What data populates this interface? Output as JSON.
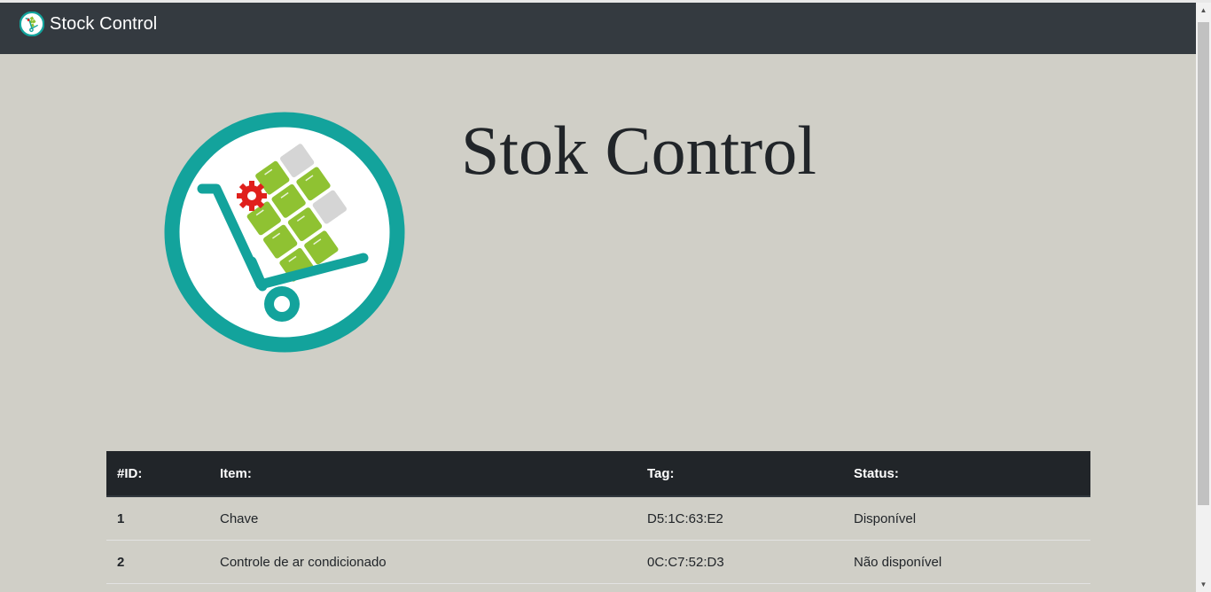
{
  "navbar": {
    "brand_text": "Stock Control",
    "brand_icon": "stock-cart-logo-icon",
    "background": "#343a40"
  },
  "hero": {
    "title": "Stok Control",
    "logo_icon": "hand-truck-boxes-logo"
  },
  "table": {
    "headers": [
      "#ID:",
      "Item:",
      "Tag:",
      "Status:"
    ],
    "rows": [
      {
        "id": "1",
        "item": "Chave",
        "tag": "D5:1C:63:E2",
        "status": "Disponível"
      },
      {
        "id": "2",
        "item": "Controle de ar condicionado",
        "tag": "0C:C7:52:D3",
        "status": "Não disponível"
      }
    ]
  },
  "colors": {
    "page_background": "#d0cfc7",
    "table_header": "#212529",
    "logo_teal": "#13a39c",
    "box_green": "#8fc232",
    "gear_red": "#e0201c"
  }
}
